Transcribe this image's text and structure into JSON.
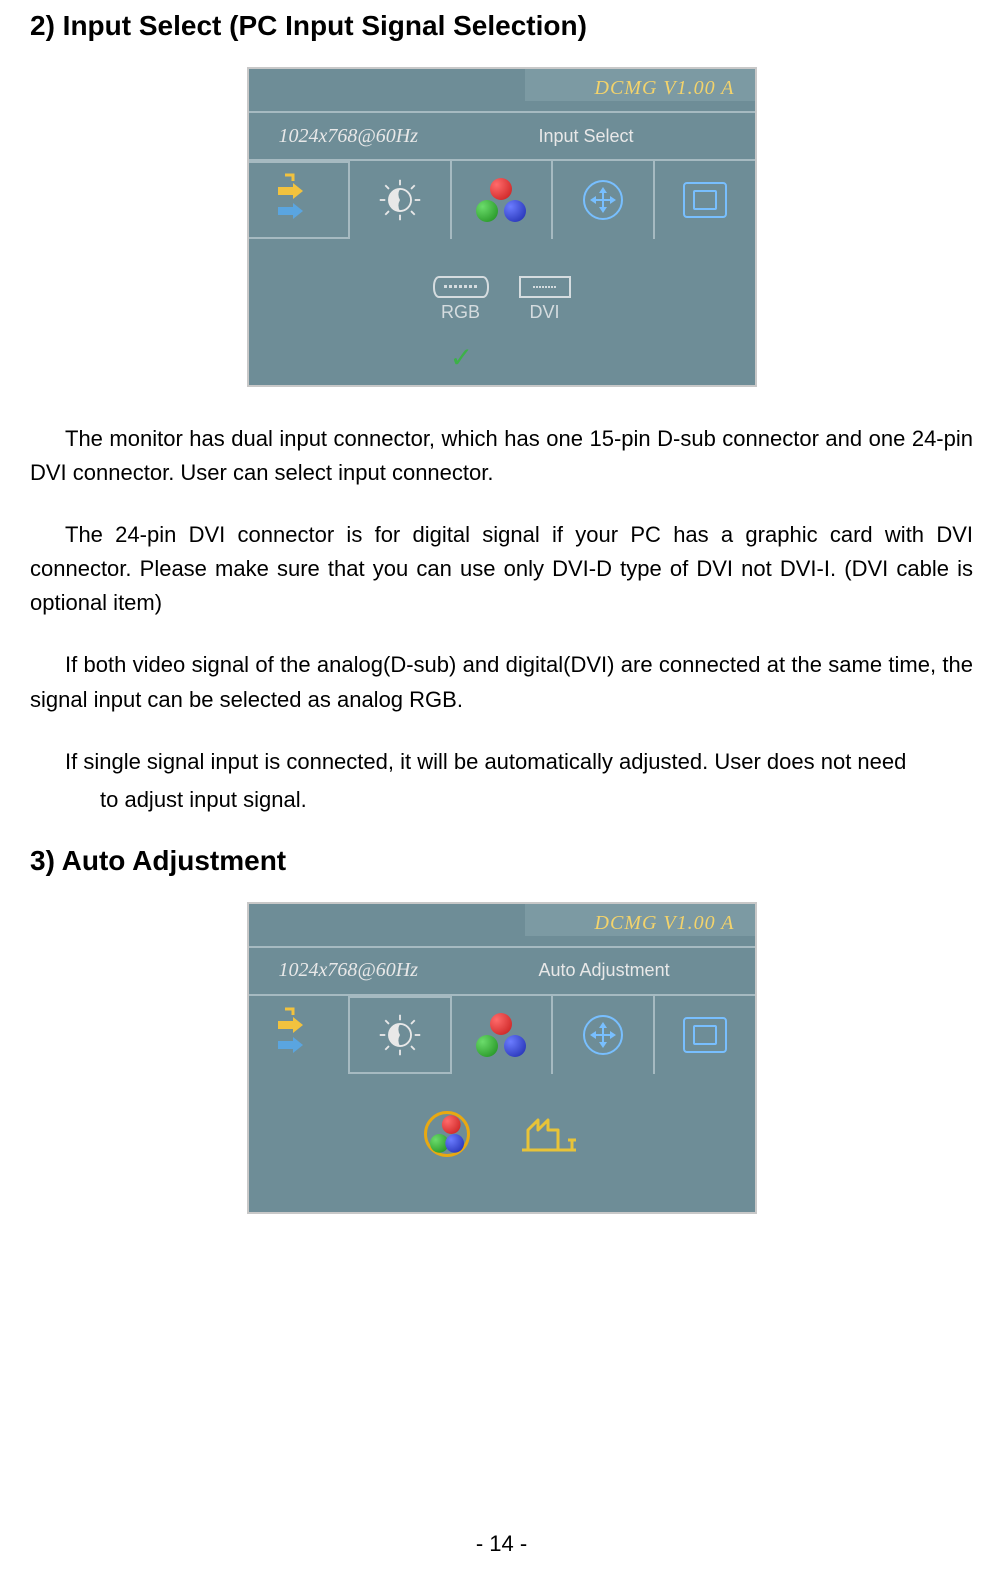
{
  "headings": {
    "section2": "2) Input Select (PC Input Signal Selection)",
    "section3": "3) Auto Adjustment"
  },
  "osd": {
    "version": "DCMG V1.00 A",
    "resolution": "1024x768@60Hz",
    "menu1": "Input Select",
    "menu2": "Auto Adjustment",
    "rgb_label": "RGB",
    "dvi_label": "DVI"
  },
  "paragraphs": {
    "p1": "The monitor has dual input connector, which has one 15-pin D-sub connector and one 24-pin DVI connector. User can select input connector.",
    "p2": "The 24-pin DVI connector is for digital signal if your PC has a graphic card with DVI connector. Please make sure that you can use only DVI-D type of DVI not DVI-I. (DVI cable is optional item)",
    "p3": "If both video signal of the analog(D-sub) and digital(DVI) are connected at the same time, the signal input can be selected as analog RGB.",
    "p4a": "If single signal input is connected, it will be automatically adjusted. User does not need",
    "p4b": "to adjust input signal."
  },
  "page_number": "- 14 -"
}
